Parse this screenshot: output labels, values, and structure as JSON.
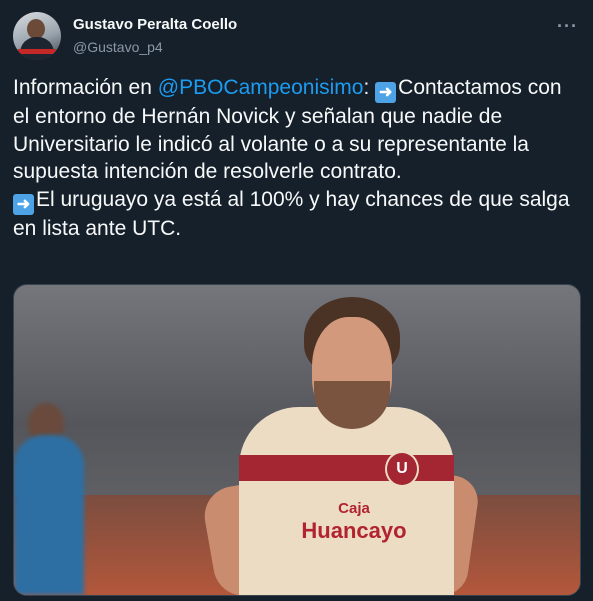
{
  "author": {
    "display_name": "Gustavo Peralta Coello",
    "handle": "@Gustavo_p4",
    "avatar_icon": "user-avatar"
  },
  "menu": {
    "more_label": "···",
    "icon": "more-options-icon"
  },
  "tweet": {
    "part1": "Información en ",
    "mention": "@PBOCampeonisimo",
    "part2": ": ",
    "arrow_glyph": "➜",
    "part3": "Contactamos con el entorno de Hernán Novick y señalan que nadie de Universitario le indicó al volante o a su representante la supuesta intención de resolverle contrato.",
    "part4": "El uruguayo ya está al 100% y hay chances de que salga en lista ante UTC."
  },
  "media": {
    "type": "photo",
    "jersey_sponsor_line1": "Caja",
    "jersey_sponsor_line2": "Huancayo",
    "jersey_crest": "U"
  },
  "colors": {
    "background": "#15202b",
    "text": "#f7f9f9",
    "secondary_text": "#8b98a5",
    "link": "#1d9bf0"
  }
}
